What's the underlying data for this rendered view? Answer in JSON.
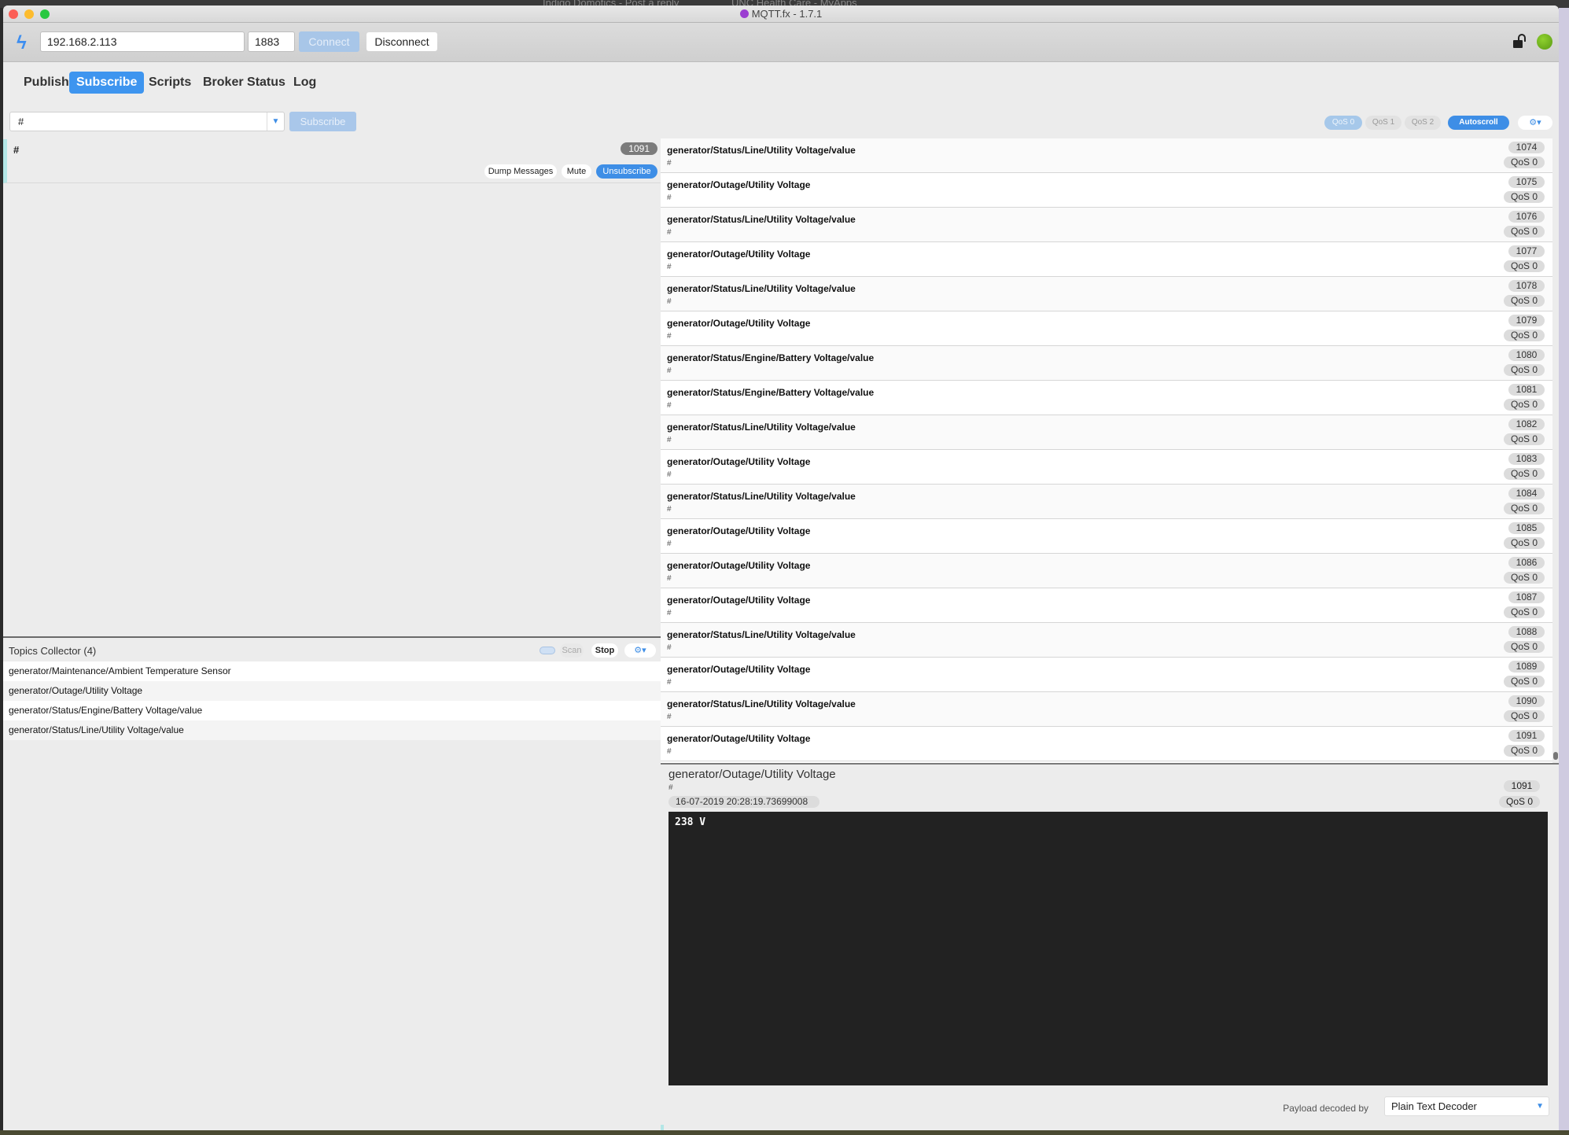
{
  "background": {
    "browser_tabs": [
      "Indigo Domotics - Post a reply",
      "UNC Health Care - MyApps"
    ]
  },
  "window": {
    "title": "MQTT.fx - 1.7.1"
  },
  "toolbar": {
    "host_value": "192.168.2.113",
    "port_value": "1883",
    "connect_label": "Connect",
    "disconnect_label": "Disconnect",
    "connection_status": "connected",
    "status_color": "#7ab51d"
  },
  "tabs": [
    {
      "label": "Publish",
      "active": false
    },
    {
      "label": "Subscribe",
      "active": true
    },
    {
      "label": "Scripts",
      "active": false
    },
    {
      "label": "Broker Status",
      "active": false
    },
    {
      "label": "Log",
      "active": false
    }
  ],
  "subscribe_bar": {
    "topic_value": "#",
    "subscribe_label": "Subscribe",
    "qos_options": [
      "QoS 0",
      "QoS 1",
      "QoS 2"
    ],
    "selected_qos": "QoS 0",
    "autoscroll_label": "Autoscroll"
  },
  "subscription": {
    "topic": "#",
    "count": "1091",
    "dump_label": "Dump Messages",
    "mute_label": "Mute",
    "unsubscribe_label": "Unsubscribe"
  },
  "topics_collector": {
    "title": "Topics Collector (4)",
    "scan_label": "Scan",
    "stop_label": "Stop",
    "topics": [
      "generator/Maintenance/Ambient Temperature Sensor",
      "generator/Outage/Utility Voltage",
      "generator/Status/Engine/Battery Voltage/value",
      "generator/Status/Line/Utility Voltage/value"
    ]
  },
  "messages": [
    {
      "topic": "generator/Status/Line/Utility Voltage/value",
      "filter": "#",
      "id": "1074",
      "qos": "QoS 0"
    },
    {
      "topic": "generator/Outage/Utility Voltage",
      "filter": "#",
      "id": "1075",
      "qos": "QoS 0"
    },
    {
      "topic": "generator/Status/Line/Utility Voltage/value",
      "filter": "#",
      "id": "1076",
      "qos": "QoS 0"
    },
    {
      "topic": "generator/Outage/Utility Voltage",
      "filter": "#",
      "id": "1077",
      "qos": "QoS 0"
    },
    {
      "topic": "generator/Status/Line/Utility Voltage/value",
      "filter": "#",
      "id": "1078",
      "qos": "QoS 0"
    },
    {
      "topic": "generator/Outage/Utility Voltage",
      "filter": "#",
      "id": "1079",
      "qos": "QoS 0"
    },
    {
      "topic": "generator/Status/Engine/Battery Voltage/value",
      "filter": "#",
      "id": "1080",
      "qos": "QoS 0"
    },
    {
      "topic": "generator/Status/Engine/Battery Voltage/value",
      "filter": "#",
      "id": "1081",
      "qos": "QoS 0"
    },
    {
      "topic": "generator/Status/Line/Utility Voltage/value",
      "filter": "#",
      "id": "1082",
      "qos": "QoS 0"
    },
    {
      "topic": "generator/Outage/Utility Voltage",
      "filter": "#",
      "id": "1083",
      "qos": "QoS 0"
    },
    {
      "topic": "generator/Status/Line/Utility Voltage/value",
      "filter": "#",
      "id": "1084",
      "qos": "QoS 0"
    },
    {
      "topic": "generator/Outage/Utility Voltage",
      "filter": "#",
      "id": "1085",
      "qos": "QoS 0"
    },
    {
      "topic": "generator/Outage/Utility Voltage",
      "filter": "#",
      "id": "1086",
      "qos": "QoS 0"
    },
    {
      "topic": "generator/Outage/Utility Voltage",
      "filter": "#",
      "id": "1087",
      "qos": "QoS 0"
    },
    {
      "topic": "generator/Status/Line/Utility Voltage/value",
      "filter": "#",
      "id": "1088",
      "qos": "QoS 0"
    },
    {
      "topic": "generator/Outage/Utility Voltage",
      "filter": "#",
      "id": "1089",
      "qos": "QoS 0"
    },
    {
      "topic": "generator/Status/Line/Utility Voltage/value",
      "filter": "#",
      "id": "1090",
      "qos": "QoS 0"
    },
    {
      "topic": "generator/Outage/Utility Voltage",
      "filter": "#",
      "id": "1091",
      "qos": "QoS 0"
    }
  ],
  "detail": {
    "topic": "generator/Outage/Utility Voltage",
    "filter": "#",
    "id": "1091",
    "timestamp": "16-07-2019  20:28:19.73699008",
    "qos": "QoS 0",
    "payload": "238 V",
    "decoder_label": "Payload decoded by",
    "decoder_value": "Plain Text Decoder"
  }
}
